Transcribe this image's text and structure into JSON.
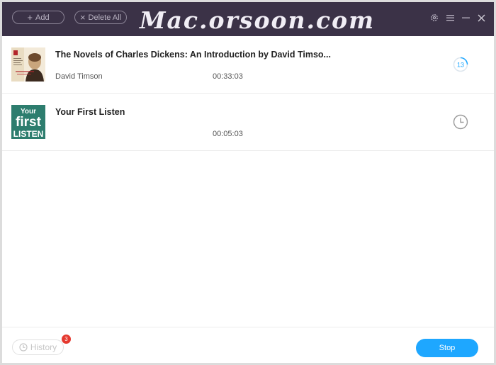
{
  "toolbar": {
    "add_label": "Add",
    "delete_all_label": "Delete All"
  },
  "watermark": "Mac.orsoon.com",
  "books": [
    {
      "title": "The Novels of Charles Dickens: An Introduction by David Timso...",
      "author": "David Timson",
      "duration": "00:33:03",
      "status": "13"
    },
    {
      "title": "Your First Listen",
      "author": "",
      "duration": "00:05:03",
      "cover_text": [
        "Your",
        "first",
        "LISTEN"
      ]
    }
  ],
  "footer": {
    "history_label": "History",
    "history_count": "3",
    "stop_label": "Stop"
  },
  "colors": {
    "titlebar": "#3b3247",
    "accent": "#1ea7ff",
    "badge": "#e5392f"
  }
}
